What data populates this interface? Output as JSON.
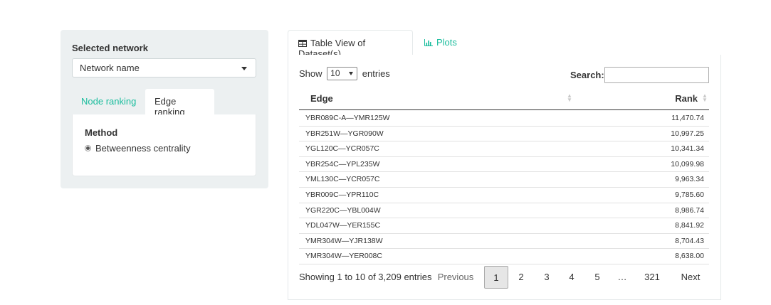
{
  "sidebar": {
    "network_label": "Selected network",
    "network_select_value": "Network name",
    "tabs": [
      {
        "label": "Node ranking",
        "active": false
      },
      {
        "label": "Edge ranking",
        "active": true
      }
    ],
    "method_title": "Method",
    "method_option": "Betweenness centrality"
  },
  "main_tabs": [
    {
      "label": "Table View of Dataset(s)",
      "icon": "table-icon",
      "active": true
    },
    {
      "label": "Plots",
      "icon": "bar-chart-icon",
      "active": false
    }
  ],
  "table": {
    "show_prefix": "Show",
    "page_length": "10",
    "show_suffix": "entries",
    "search_label": "Search:",
    "search_value": "",
    "columns": [
      "Edge",
      "Rank"
    ],
    "rows": [
      {
        "edge": "YBR089C-A—YMR125W",
        "rank": "11,470.74"
      },
      {
        "edge": "YBR251W—YGR090W",
        "rank": "10,997.25"
      },
      {
        "edge": "YGL120C—YCR057C",
        "rank": "10,341.34"
      },
      {
        "edge": "YBR254C—YPL235W",
        "rank": "10,099.98"
      },
      {
        "edge": "YML130C—YCR057C",
        "rank": "9,963.34"
      },
      {
        "edge": "YBR009C—YPR110C",
        "rank": "9,785.60"
      },
      {
        "edge": "YGR220C—YBL004W",
        "rank": "8,986.74"
      },
      {
        "edge": "YDL047W—YER155C",
        "rank": "8,841.92"
      },
      {
        "edge": "YMR304W—YJR138W",
        "rank": "8,704.43"
      },
      {
        "edge": "YMR304W—YER008C",
        "rank": "8,638.00"
      }
    ],
    "info": "Showing 1 to 10 of 3,209 entries",
    "pagination": {
      "previous": "Previous",
      "pages": [
        "1",
        "2",
        "3",
        "4",
        "5",
        "…",
        "321"
      ],
      "current": "1",
      "next": "Next"
    }
  },
  "colors": {
    "accent": "#18bc9c",
    "sidebar_bg": "#ecf0f1"
  }
}
